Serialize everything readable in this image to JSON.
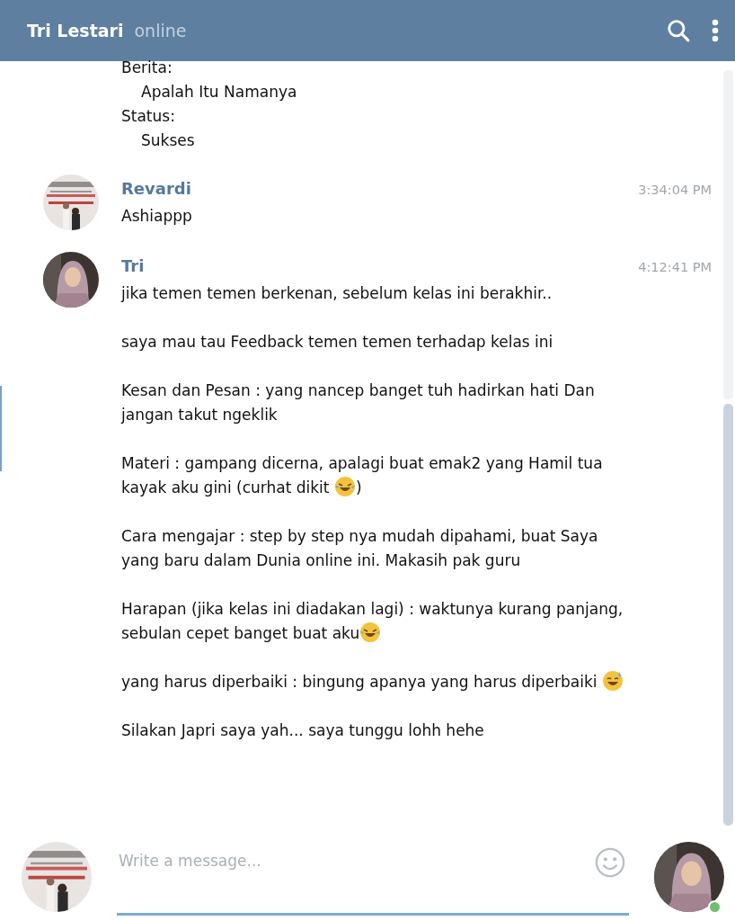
{
  "header": {
    "title": "Tri Lestari",
    "status": "online"
  },
  "previous_message": {
    "lines": [
      {
        "label": "Berita:",
        "children": [
          {
            "label": "Apalah Itu Namanya"
          }
        ]
      },
      {
        "label": "Status:",
        "children": [
          {
            "label": "Sukses"
          }
        ]
      }
    ]
  },
  "messages": [
    {
      "author": "Revardi",
      "time": "3:34:04 PM",
      "paragraphs": [
        [
          {
            "kind": "text",
            "text": "Ashiappp"
          }
        ]
      ]
    },
    {
      "author": "Tri",
      "time": "4:12:41 PM",
      "paragraphs": [
        [
          {
            "kind": "text",
            "text": "jika temen temen berkenan, sebelum kelas ini berakhir.."
          }
        ],
        [
          {
            "kind": "text",
            "text": "saya mau tau Feedback temen temen terhadap kelas ini"
          }
        ],
        [
          {
            "kind": "text",
            "text": "Kesan dan Pesan : yang nancep banget tuh hadirkan hati Dan jangan takut ngeklik"
          }
        ],
        [
          {
            "kind": "text",
            "text": "Materi : gampang dicerna, apalagi buat emak2 yang Hamil tua kayak aku gini (curhat dikit "
          },
          {
            "kind": "tears"
          },
          {
            "kind": "text",
            "text": ")"
          }
        ],
        [
          {
            "kind": "text",
            "text": "Cara mengajar : step by step nya mudah dipahami, buat Saya yang baru dalam Dunia online ini. Makasih pak guru"
          }
        ],
        [
          {
            "kind": "text",
            "text": "Harapan (jika kelas ini diadakan lagi) : waktunya kurang panjang, sebulan cepet banget buat aku"
          },
          {
            "kind": "tears"
          }
        ],
        [
          {
            "kind": "text",
            "text": "yang harus diperbaiki : bingung apanya yang harus diperbaiki "
          },
          {
            "kind": "sweat"
          }
        ],
        [
          {
            "kind": "text",
            "text": "Silakan Japri saya yah... saya tunggu lohh hehe"
          }
        ]
      ]
    }
  ],
  "composer": {
    "placeholder": "Write a message...",
    "peer_online": true
  }
}
